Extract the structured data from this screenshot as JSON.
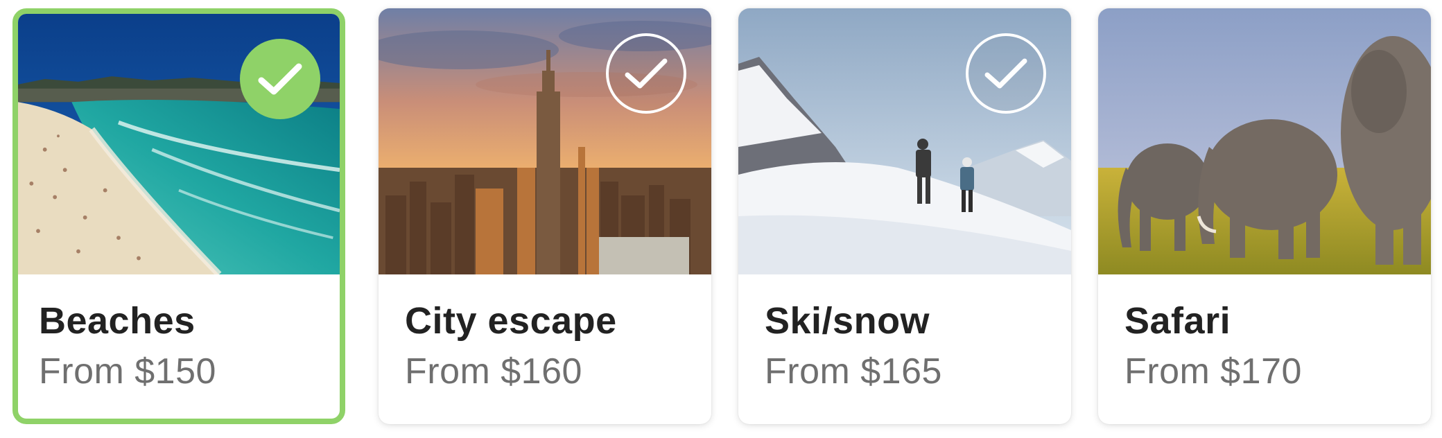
{
  "colors": {
    "selected_accent": "#8fd268",
    "title_text": "#222222",
    "price_text": "#6f6f6f"
  },
  "cards": [
    {
      "title": "Beaches",
      "price": "From $150",
      "selected": true,
      "image": "beach-photo"
    },
    {
      "title": "City escape",
      "price": "From $160",
      "selected": false,
      "image": "city-skyline-photo"
    },
    {
      "title": "Ski/snow",
      "price": "From $165",
      "selected": false,
      "image": "snow-mountain-photo"
    },
    {
      "title": "Safari",
      "price": "From $170",
      "selected": false,
      "image": "elephants-photo"
    }
  ],
  "icons": {
    "check": "check-icon"
  }
}
